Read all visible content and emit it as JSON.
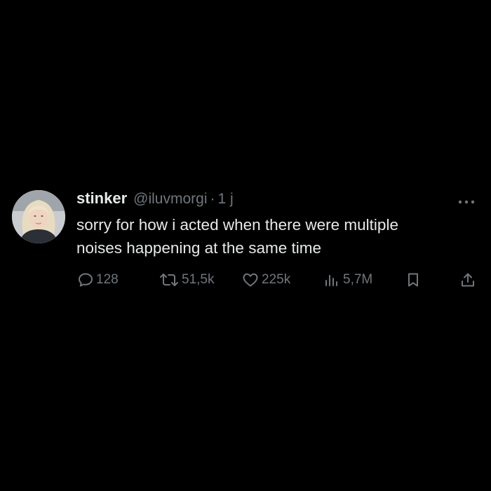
{
  "tweet": {
    "display_name": "stinker",
    "handle": "@iluvmorgi",
    "separator": "·",
    "time": "1 j",
    "text_lines": [
      "sorry for how i acted when there were multiple",
      "noises happening at the same time"
    ]
  },
  "metrics": {
    "replies": "128",
    "reposts": "51,5k",
    "likes": "225k",
    "views": "5,7M"
  },
  "icons": {
    "reply": "speech-bubble",
    "repost": "repost-arrows",
    "like": "heart-outline",
    "views": "bar-chart",
    "bookmark": "bookmark-outline",
    "share": "upload-arrow",
    "more": "three-dots"
  },
  "colors": {
    "background": "#000000",
    "primary_text": "#e7e9ea",
    "secondary_text": "#71767b"
  }
}
